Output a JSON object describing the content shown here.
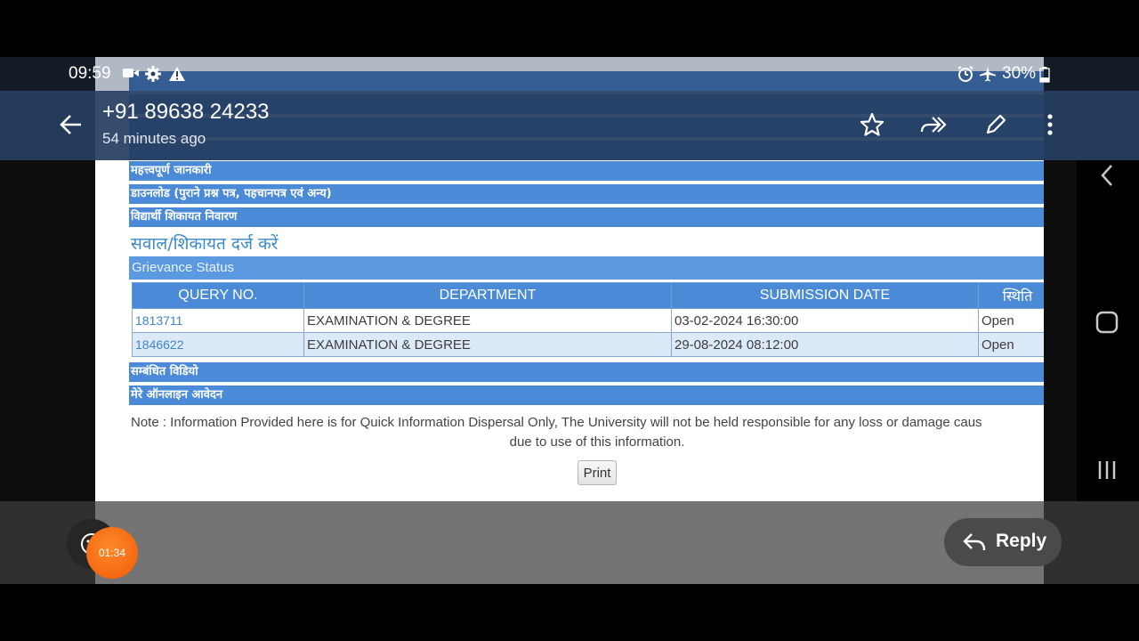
{
  "status_bar": {
    "time": "09:59",
    "battery": "30%"
  },
  "app_bar": {
    "sender": "+91 89638 24233",
    "time_ago": "54 minutes ago"
  },
  "page": {
    "menu_rows": [
      "महत्त्वपूर्ण जानकारी",
      "डाउनलोड (पुराने प्रश्न पत्र, पहचानपत्र एवं अन्य)",
      "विद्यार्थी शिकायत निवारण"
    ],
    "complaint_heading": "सवाल/शिकायत दर्ज करें",
    "grievance_status": "Grievance Status",
    "table": {
      "headers": [
        "QUERY NO.",
        "DEPARTMENT",
        "SUBMISSION DATE",
        "स्थिति"
      ],
      "rows": [
        [
          "1813711",
          "EXAMINATION & DEGREE",
          "03-02-2024 16:30:00",
          "Open"
        ],
        [
          "1846622",
          "EXAMINATION & DEGREE",
          "29-08-2024 08:12:00",
          "Open"
        ]
      ]
    },
    "lower_rows": [
      "सम्बंधित विडियो",
      "मेरे ऑनलाइन आवेदन"
    ],
    "note_line1": "Note : Information Provided here is for Quick Information Dispersal Only, The University will not be held responsible for any loss or damage caus",
    "note_line2": "due to use of this information.",
    "print_label": "Print"
  },
  "bottom": {
    "recording_time": "01:34",
    "reply_label": "Reply"
  },
  "colors": {
    "header_blue": "#4a8ad6",
    "app_bar": "#263e62",
    "record_orange": "#f05a08"
  }
}
